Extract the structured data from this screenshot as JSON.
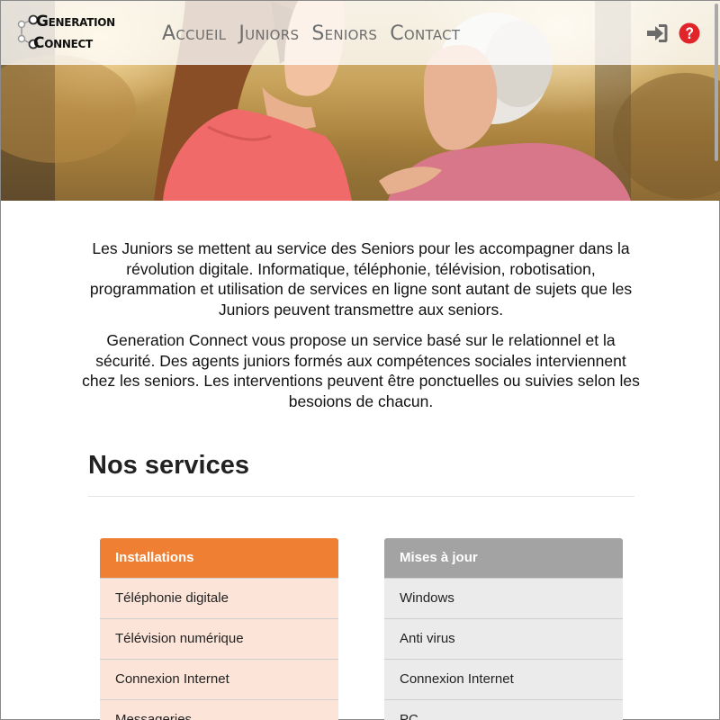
{
  "brand": {
    "line1_initial": "G",
    "line1_rest": "ENERATION",
    "line2_initial": "C",
    "line2_rest": "ONNECT"
  },
  "nav": {
    "items": [
      {
        "label": "Accueil"
      },
      {
        "label": "Juniors"
      },
      {
        "label": "Seniors"
      },
      {
        "label": "Contact"
      }
    ],
    "login_icon": "sign-in-icon",
    "help_icon": "question-circle-icon"
  },
  "hero": {
    "image": "junior-and-senior-photo"
  },
  "intro": {
    "paragraph1": "Les Juniors se mettent au service des Seniors pour les accompagner dans la révolution digitale. Informatique, téléphonie, télévision, robotisation, programmation et utilisation de services en ligne sont autant de sujets que les Juniors peuvent transmettre aux seniors.",
    "paragraph2": "Generation Connect vous propose un service basé sur le relationnel et la sécurité. Des agents juniors formés aux compétences sociales interviennent chez les seniors. Les interventions peuvent être ponctuelles ou suivies selon les besoions de chacun."
  },
  "services": {
    "title": "Nos services",
    "panels": [
      {
        "heading": "Installations",
        "items": [
          "Téléphonie digitale",
          "Télévision numérique",
          "Connexion Internet",
          "Messageries"
        ]
      },
      {
        "heading": "Mises à jour",
        "items": [
          "Windows",
          "Anti virus",
          "Connexion Internet",
          "PC"
        ]
      }
    ]
  },
  "colors": {
    "accent_orange": "#ef7f33",
    "panel_orange_bg": "#fce5d8",
    "panel_grey_header": "#a3a3a3",
    "panel_grey_bg": "#ebebeb",
    "help_red": "#e0242a"
  }
}
